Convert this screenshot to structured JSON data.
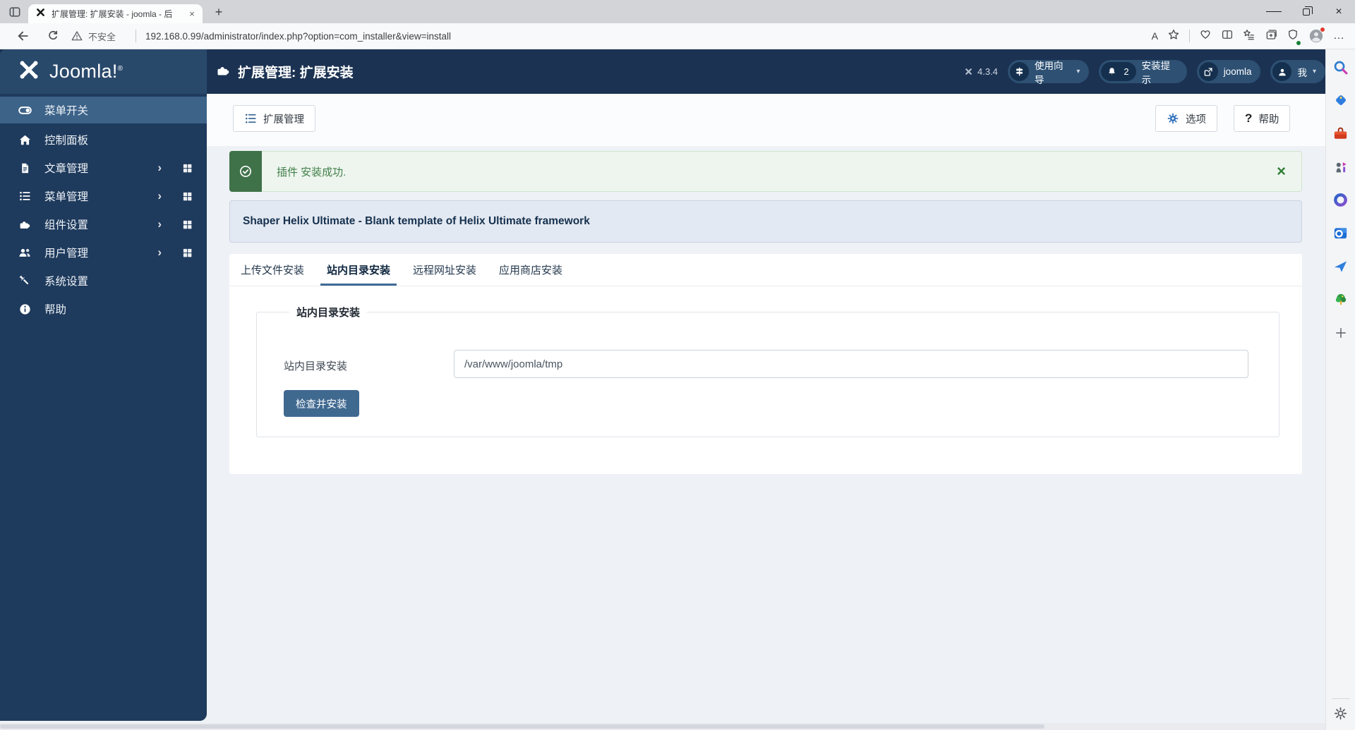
{
  "browser": {
    "tab": {
      "title": "扩展管理: 扩展安装 - joomla - 后",
      "close_glyph": "×",
      "new_tab_glyph": "+"
    },
    "window_controls": [
      "minimize",
      "restore",
      "close"
    ],
    "address": {
      "security_label": "不安全",
      "url": "192.168.0.99/administrator/index.php?option=com_installer&view=install"
    },
    "toolbar_icons": [
      "back",
      "refresh",
      "read-aloud",
      "favorite-star",
      "browser-essentials",
      "split-screen",
      "favorites-bar",
      "collections",
      "extensions-shield",
      "profile-avatar",
      "more-menu"
    ],
    "read_aloud_glyph": "A",
    "more_glyph": "…"
  },
  "header": {
    "logo_text": "Joomla!",
    "logo_reg": "®",
    "page_title": "扩展管理: 扩展安装",
    "version": "4.3.4",
    "pills": [
      {
        "label": "使用向导",
        "has_chevron": true
      },
      {
        "badge": "2",
        "label": "安装提示"
      },
      {
        "label": "joomla"
      },
      {
        "label": "我",
        "has_chevron": true
      }
    ],
    "chevron_glyph": "▾"
  },
  "sidebar": {
    "items": [
      {
        "label": "菜单开关",
        "icon": "toggle",
        "active": true
      },
      {
        "label": "控制面板",
        "icon": "home"
      },
      {
        "label": "文章管理",
        "icon": "document",
        "expandable": true
      },
      {
        "label": "菜单管理",
        "icon": "list",
        "expandable": true
      },
      {
        "label": "组件设置",
        "icon": "puzzle",
        "expandable": true
      },
      {
        "label": "用户管理",
        "icon": "users",
        "expandable": true
      },
      {
        "label": "系统设置",
        "icon": "wrench"
      },
      {
        "label": "帮助",
        "icon": "info"
      }
    ],
    "chevron_glyph": "›"
  },
  "toolbar": {
    "extensions_label": "扩展管理",
    "options_label": "选项",
    "help_label": "帮助",
    "help_glyph": "?"
  },
  "alert": {
    "message": "插件 安装成功.",
    "close_glyph": "×"
  },
  "template_bar": {
    "text": "Shaper Helix Ultimate - Blank template of Helix Ultimate framework"
  },
  "tabs": [
    {
      "label": "上传文件安装"
    },
    {
      "label": "站内目录安装",
      "active": true
    },
    {
      "label": "远程网址安装"
    },
    {
      "label": "应用商店安装"
    }
  ],
  "form": {
    "legend": "站内目录安装",
    "field_label": "站内目录安装",
    "field_value": "/var/www/joomla/tmp",
    "submit_label": "检查并安装"
  },
  "edge_sidebar": {
    "icons": [
      "search",
      "shopping",
      "tools",
      "games",
      "microsoft-365",
      "outlook",
      "drop",
      "tree",
      "add"
    ],
    "bottom_icon": "settings-gear"
  },
  "colors": {
    "header_navy": "#1b3252",
    "brand_blue": "#29496b",
    "sidebar_navy": "#1e3a5c",
    "sidebar_active": "#3d6389",
    "pill_blue": "#2d5073",
    "pill_circle": "#15304e",
    "success_green": "#40724a",
    "success_bg": "#eef5ee",
    "accent_steel_blue": "#406990",
    "tab_underline": "#3e6b95",
    "template_bar_bg": "#e3e9f2"
  }
}
